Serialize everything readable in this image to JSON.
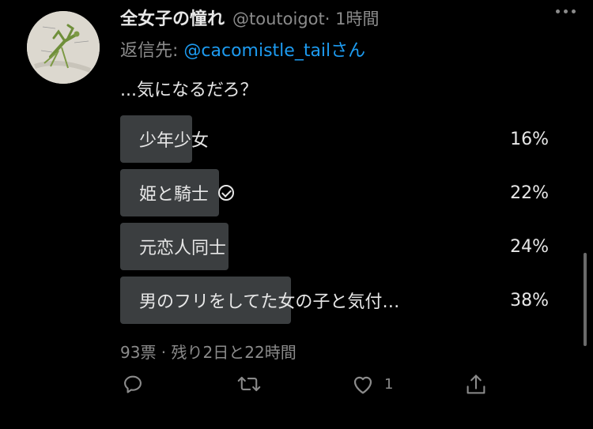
{
  "author": {
    "name": "全女子の憧れ",
    "handle": "@toutoigot",
    "time": "· 1時間"
  },
  "reply": {
    "prefix": "返信先: ",
    "mention": "@cacomistle_tail",
    "suffix": "さん"
  },
  "tweet": {
    "text": "...気になるだろ？"
  },
  "poll": {
    "options": [
      {
        "label": "少年少女",
        "percent_label": "16%",
        "percent": 16,
        "voted": false
      },
      {
        "label": "姫と騎士",
        "percent_label": "22%",
        "percent": 22,
        "voted": true
      },
      {
        "label": "元恋人同士",
        "percent_label": "24%",
        "percent": 24,
        "voted": false
      },
      {
        "label": "男のフリをしてた女の子と気付…",
        "percent_label": "38%",
        "percent": 38,
        "voted": false
      }
    ],
    "meta": "93票 · 残り2日と22時間"
  },
  "actions": {
    "like_count": "1",
    "icons": [
      "reply-icon",
      "retweet-icon",
      "like-icon",
      "share-icon"
    ]
  },
  "colors": {
    "background": "#000000",
    "bar": "#3b3e40",
    "mention": "#1d9bf0",
    "muted": "#8b8b8b"
  }
}
